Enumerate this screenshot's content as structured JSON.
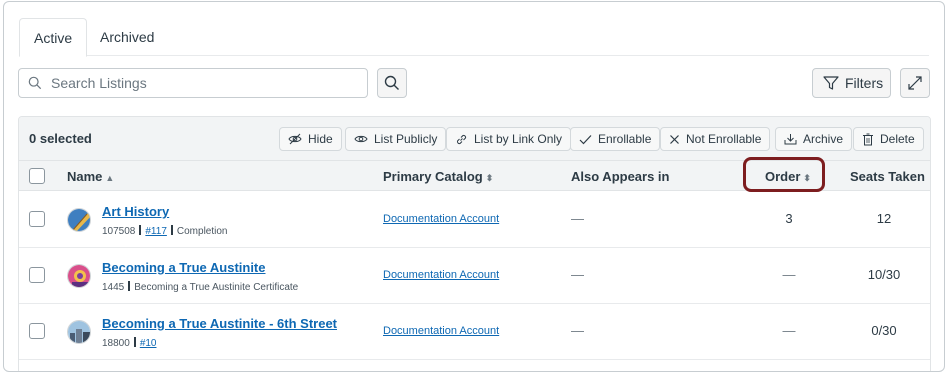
{
  "tabs": [
    {
      "label": "Active",
      "selected": true
    },
    {
      "label": "Archived",
      "selected": false
    }
  ],
  "search": {
    "placeholder": "Search Listings",
    "value": ""
  },
  "filters_label": "Filters",
  "toolbar": {
    "selected_count": "0 selected",
    "actions": [
      {
        "label": "Hide",
        "icon": "eye-slash-icon"
      },
      {
        "label": "List Publicly",
        "icon": "eye-icon"
      },
      {
        "label": "List by Link Only",
        "icon": "link-icon"
      },
      {
        "label": "Enrollable",
        "icon": "check-icon"
      },
      {
        "label": "Not Enrollable",
        "icon": "x-icon"
      },
      {
        "label": "Archive",
        "icon": "archive-icon"
      },
      {
        "label": "Delete",
        "icon": "trash-icon"
      }
    ]
  },
  "columns": {
    "name": "Name",
    "primary_catalog": "Primary Catalog",
    "also_appears_in": "Also Appears in",
    "order": "Order",
    "seats_taken": "Seats Taken"
  },
  "sort_ascending_indicator": "▲",
  "sortable_indicator": "⬍",
  "rows": [
    {
      "name": "Art History",
      "id": "107508",
      "tag": "#117",
      "detail": "Completion",
      "primary_catalog": "Documentation Account",
      "also_appears_in": "—",
      "order": "3",
      "seats_taken": "12"
    },
    {
      "name": "Becoming a True Austinite",
      "id": "1445",
      "tag": "",
      "detail": "Becoming a True Austinite Certificate",
      "primary_catalog": "Documentation Account",
      "also_appears_in": "—",
      "order": "—",
      "seats_taken": "10/30"
    },
    {
      "name": "Becoming a True Austinite - 6th Street",
      "id": "18800",
      "tag": "#10",
      "detail": "",
      "primary_catalog": "Documentation Account",
      "also_appears_in": "—",
      "order": "—",
      "seats_taken": "0/30"
    }
  ],
  "colors": {
    "link": "#0e68b3",
    "highlight": "#7d1d1f",
    "header_bg": "#f2f4f5"
  }
}
